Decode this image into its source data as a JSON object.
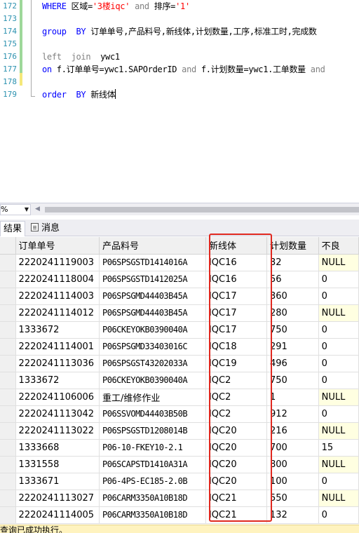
{
  "editor": {
    "line_numbers": [
      "172",
      "173",
      "174",
      "175",
      "176",
      "177",
      "178",
      "179"
    ],
    "line172": {
      "kw1": "WHERE",
      "t1": " 区域=",
      "s1": "'3楼iqc'",
      "kw2": "and",
      "t2": "  排序=",
      "s2": "'1'"
    },
    "line174": {
      "kw1": "group",
      "kw2": "BY",
      "t1": " 订单单号,产品料号,新线体,计划数量,工序,标准工时,完成数"
    },
    "line176": {
      "g1": "left",
      "g2": "join",
      "t1": "ywc1"
    },
    "line177": {
      "kw1": "on",
      "t1": "  f.订单单号=ywc1.SAPOrderID ",
      "g1": "and",
      "t2": "  f.计划数量=ywc1.工单数量 ",
      "g2": "and"
    },
    "line179": {
      "kw1": "order",
      "kw2": "BY",
      "t1": "  新线体"
    }
  },
  "zoom": {
    "value": "%"
  },
  "tabs": {
    "results": "结果",
    "messages": "消息"
  },
  "grid": {
    "columns": [
      "订单单号",
      "产品料号",
      "新线体",
      "计划数量",
      "不良"
    ],
    "rows": [
      [
        "2220241119003",
        "P06SPSGSTD1414016A",
        "IQC16",
        "32",
        "NULL"
      ],
      [
        "2220241118004",
        "P06SPSGSTD1412025A",
        "IQC16",
        "56",
        "0"
      ],
      [
        "2220241114003",
        "P06SPSGMD44403B45A",
        "IQC17",
        "360",
        "0"
      ],
      [
        "2220241114012",
        "P06SPSGMD44403B45A",
        "IQC17",
        "280",
        "NULL"
      ],
      [
        "1333672",
        "P06CKEYOKB0390040A",
        "IQC17",
        "750",
        "0"
      ],
      [
        "2220241114001",
        "P06SPSGMD33403016C",
        "IQC18",
        "291",
        "0"
      ],
      [
        "2220241113036",
        "P06SPSGST43202033A",
        "IQC19",
        "496",
        "0"
      ],
      [
        "1333672",
        "P06CKEYOKB0390040A",
        "IQC2",
        "750",
        "0"
      ],
      [
        "2220241106006",
        "重工/维修作业",
        "IQC2",
        "1",
        "NULL"
      ],
      [
        "2220241113042",
        "P06SSVOMD44403B50B",
        "IQC2",
        "912",
        "0"
      ],
      [
        "2220241113022",
        "P06SPSGSTD1208014B",
        "IQC20",
        "216",
        "NULL"
      ],
      [
        "1333668",
        "P06-10-FKEY10-2.1",
        "IQC20",
        "700",
        "15"
      ],
      [
        "1331558",
        "P06SCAPSTD1410A31A",
        "IQC20",
        "800",
        "NULL"
      ],
      [
        "1333671",
        "P06-4PS-EC185-2.0B",
        "IQC20",
        "100",
        "0"
      ],
      [
        "2220241113027",
        "P06CARM3350A10B18D",
        "IQC21",
        "550",
        "NULL"
      ],
      [
        "2220241114005",
        "P06CARM3350A10B18D",
        "IQC21",
        "132",
        "0"
      ]
    ]
  },
  "status": {
    "text": "查询已成功执行。"
  }
}
